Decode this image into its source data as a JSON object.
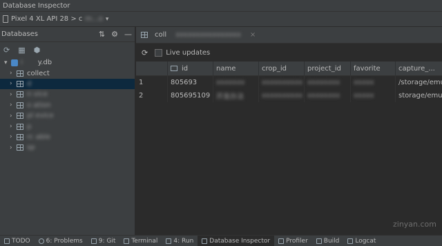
{
  "window": {
    "title": "Database Inspector"
  },
  "device": {
    "label": "Pixel 4 XL API 28 > c",
    "blurred_suffix": "m...o"
  },
  "left_panel": {
    "title": "Databases",
    "tree": {
      "root": {
        "blurred_prefix": "i",
        "label": "y.db"
      },
      "items": [
        {
          "label": "collect",
          "blurred": false
        },
        {
          "label": "d",
          "blurred": true,
          "selected": true
        },
        {
          "label": "n      vice",
          "blurred": true
        },
        {
          "label": "o      ation",
          "blurred": true
        },
        {
          "label": "pl     evice",
          "blurred": true
        },
        {
          "label": "p",
          "blurred": true
        },
        {
          "label": "rc            able",
          "blurred": true
        },
        {
          "label": "sp",
          "blurred": true
        }
      ]
    }
  },
  "tab": {
    "label": "coll"
  },
  "toolbar": {
    "live_updates": "Live updates"
  },
  "table": {
    "columns": [
      "id",
      "name",
      "crop_id",
      "project_id",
      "favorite",
      "capture_..."
    ],
    "rows": [
      {
        "n": "1",
        "id": "805693",
        "name": "",
        "path": "/storage/emu"
      },
      {
        "n": "2",
        "id": "805695109",
        "name": "开发办法",
        "path": "storage/emu"
      }
    ]
  },
  "statusbar": {
    "items": [
      {
        "label": "TODO"
      },
      {
        "label": "6: Problems"
      },
      {
        "label": "9: Git"
      },
      {
        "label": "Terminal"
      },
      {
        "label": "4: Run"
      },
      {
        "label": "Database Inspector",
        "active": true
      },
      {
        "label": "Profiler"
      },
      {
        "label": "Build"
      },
      {
        "label": "Logcat"
      }
    ]
  },
  "watermark": "zinyan.com"
}
